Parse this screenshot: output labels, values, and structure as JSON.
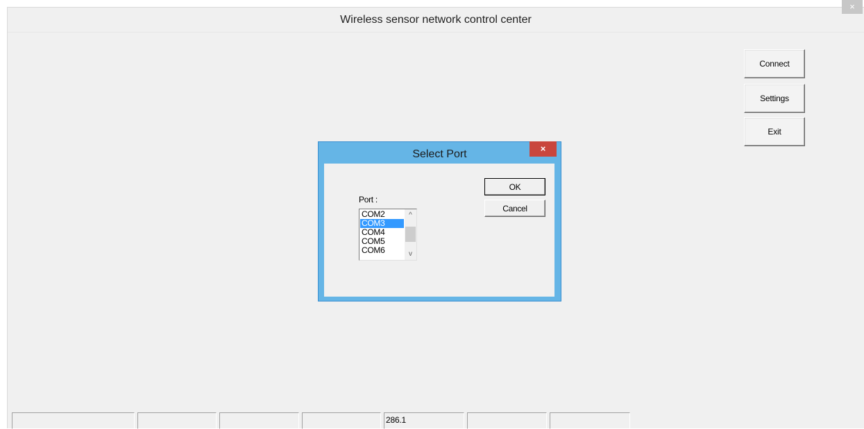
{
  "window": {
    "title": "Wireless sensor network control center",
    "close_glyph": "×"
  },
  "buttons": {
    "connect": "Connect",
    "settings": "Settings",
    "exit": "Exit"
  },
  "dialog": {
    "title": "Select Port",
    "close_glyph": "×",
    "port_label": "Port :",
    "ok_label": "OK",
    "cancel_label": "Cancel",
    "ports": [
      "COM2",
      "COM3",
      "COM4",
      "COM5",
      "COM6"
    ],
    "selected_port": "COM3",
    "scroll_up_glyph": "^",
    "scroll_down_glyph": "v"
  },
  "statusbar": {
    "panes": [
      "",
      "",
      "",
      "",
      "286.1",
      "",
      ""
    ]
  },
  "colors": {
    "dialog_frame": "#65b5e6",
    "dialog_close": "#c9463d",
    "selection": "#3399ff"
  }
}
